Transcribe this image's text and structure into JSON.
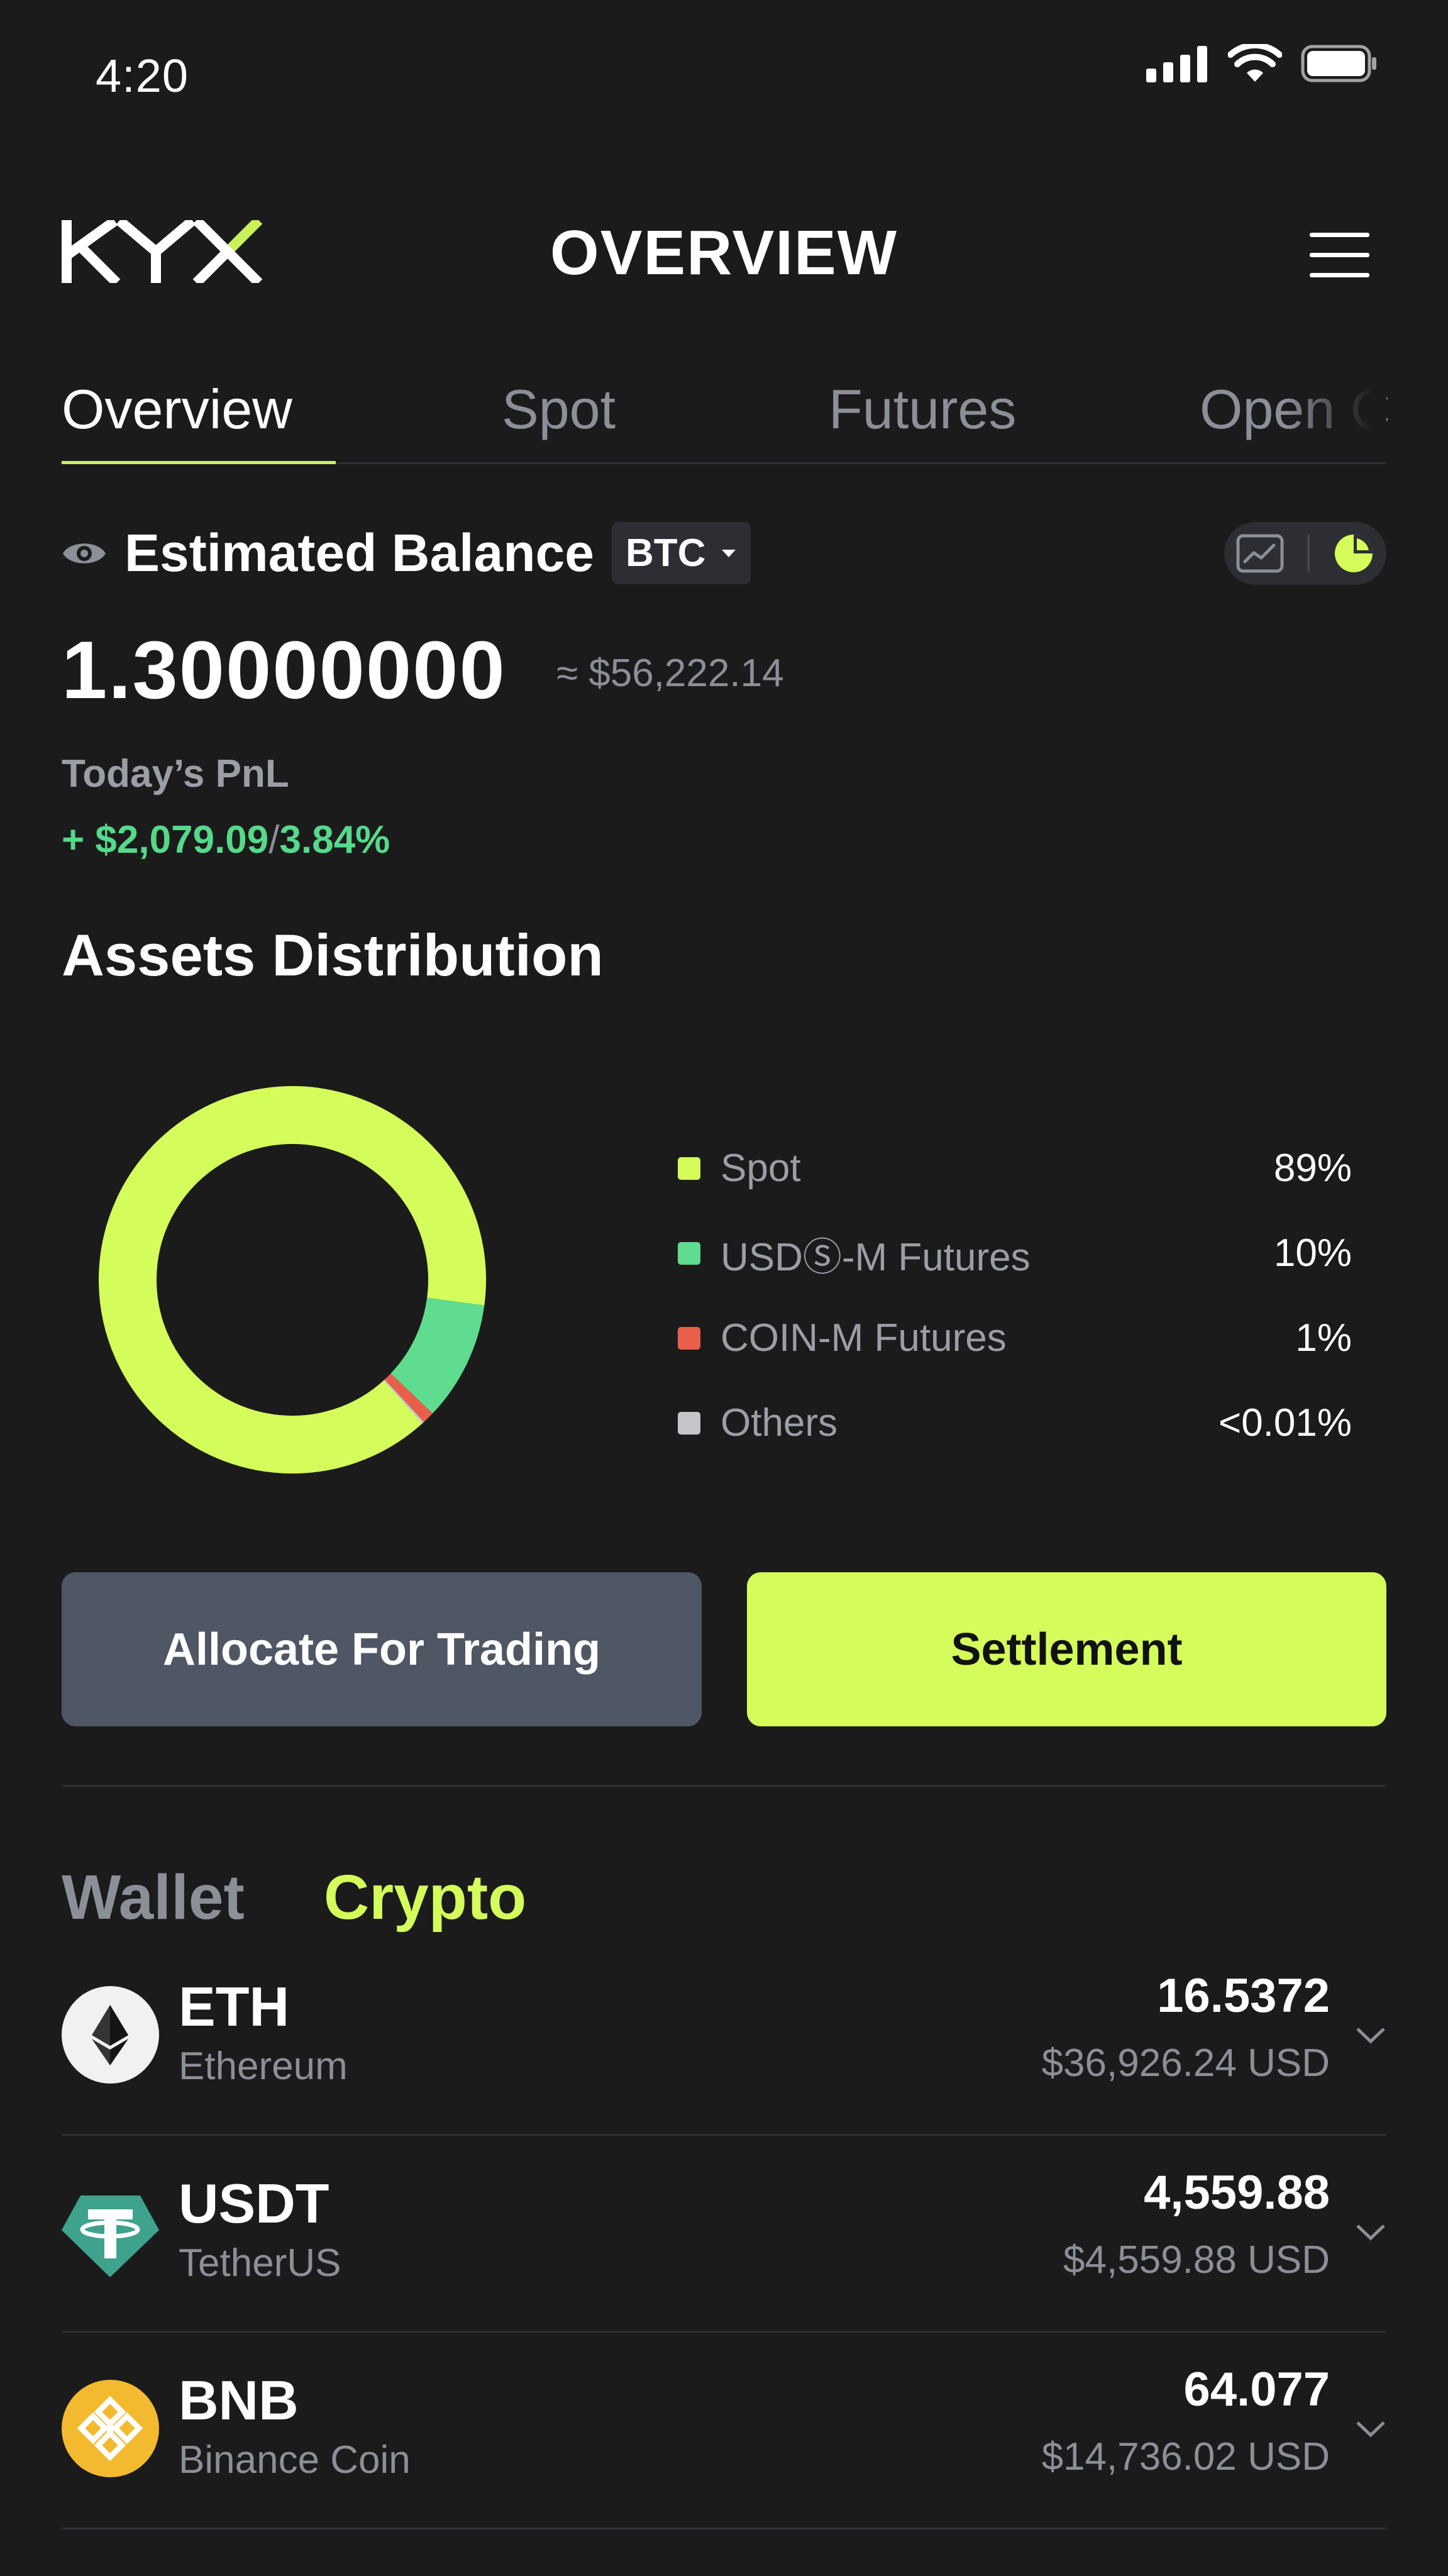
{
  "status_bar": {
    "time": "4:20"
  },
  "header": {
    "logo_text": "KYX",
    "title": "OVERVIEW"
  },
  "tabs": [
    {
      "label": "Overview",
      "active": true
    },
    {
      "label": "Spot",
      "active": false
    },
    {
      "label": "Futures",
      "active": false
    },
    {
      "label": "Open C",
      "active": false
    }
  ],
  "balance": {
    "label": "Estimated Balance",
    "currency": "BTC",
    "amount": "1.30000000",
    "usd_approx": "≈ $56,222.14",
    "pnl_label": "Today’s PnL",
    "pnl_amount": "+ $2,079.09",
    "pnl_separator": "/",
    "pnl_percent": "3.84%"
  },
  "distribution": {
    "title": "Assets Distribution",
    "items": [
      {
        "name": "Spot",
        "percent": "89%",
        "color": "#d4fc5a"
      },
      {
        "name": "USDⓈ-M Futures",
        "percent": "10%",
        "color": "#5fdc8f"
      },
      {
        "name": "COIN-M Futures",
        "percent": "1%",
        "color": "#e8604c"
      },
      {
        "name": "Others",
        "percent": "<0.01%",
        "color": "#c4c6cc"
      }
    ]
  },
  "chart_data": {
    "type": "pie",
    "categories": [
      "Spot",
      "USDⓈ-M Futures",
      "COIN-M Futures",
      "Others"
    ],
    "values": [
      89,
      10,
      1,
      0.01
    ],
    "title": "Assets Distribution"
  },
  "actions": {
    "allocate_label": "Allocate For Trading",
    "settlement_label": "Settlement"
  },
  "list_tabs": {
    "wallet_label": "Wallet",
    "crypto_label": "Crypto",
    "active": "Crypto"
  },
  "assets": [
    {
      "symbol": "ETH",
      "name": "Ethereum",
      "quantity": "16.5372",
      "usd": "$36,926.24 USD",
      "icon": "ethereum-icon"
    },
    {
      "symbol": "USDT",
      "name": "TetherUS",
      "quantity": "4,559.88",
      "usd": "$4,559.88 USD",
      "icon": "tether-icon"
    },
    {
      "symbol": "BNB",
      "name": "Binance Coin",
      "quantity": "64.077",
      "usd": "$14,736.02 USD",
      "icon": "bnb-icon"
    }
  ],
  "colors": {
    "background": "#1b1b1c",
    "accent": "#d4fc5a",
    "positive": "#5fdc8f",
    "muted": "#8b8f98"
  }
}
